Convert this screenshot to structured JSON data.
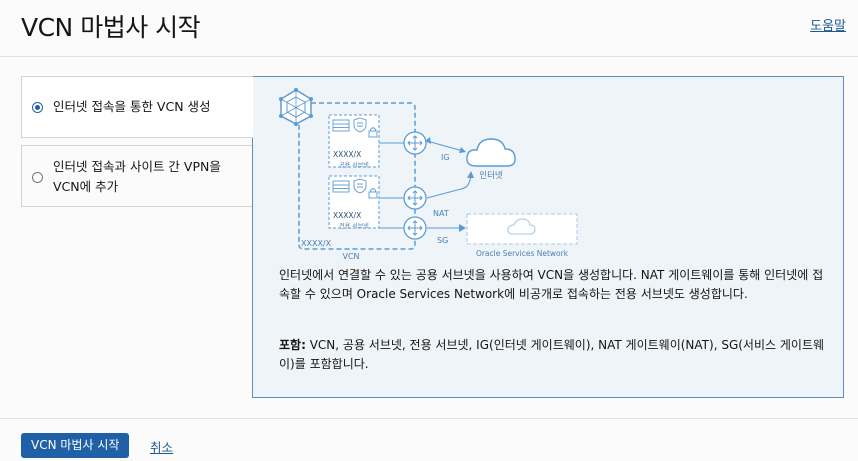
{
  "header": {
    "title": "VCN 마법사 시작",
    "help_label": "도움말"
  },
  "options": [
    {
      "label": "인터넷 접속을 통한 VCN 생성",
      "selected": true
    },
    {
      "label": "인터넷 접속과 사이트 간 VPN을 VCN에 추가",
      "selected": false
    }
  ],
  "diagram": {
    "vcn_label": "VCN",
    "vcn_cidr": "XXXX/X",
    "public_subnet_label": "공용 서브넷",
    "public_subnet_cidr": "XXXX/X",
    "private_subnet_label": "전용 서브넷",
    "private_subnet_cidr": "XXXX/X",
    "ig_label": "IG",
    "nat_label": "NAT",
    "sg_label": "SG",
    "internet_label": "인터넷",
    "osn_label": "Oracle Services Network",
    "accent_color": "#5b9bd5"
  },
  "detail": {
    "description": "인터넷에서 연결할 수 있는 공용 서브넷을 사용하여 VCN을 생성합니다. NAT 게이트웨이를 통해 인터넷에 접속할 수 있으며 Oracle Services Network에 비공개로 접속하는 전용 서브넷도 생성합니다.",
    "includes_label": "포함:",
    "includes_text": " VCN, 공용 서브넷, 전용 서브넷, IG(인터넷 게이트웨이), NAT 게이트웨이(NAT), SG(서비스 게이트웨이)를 포함합니다."
  },
  "footer": {
    "start_label": "VCN 마법사 시작",
    "cancel_label": "취소"
  }
}
